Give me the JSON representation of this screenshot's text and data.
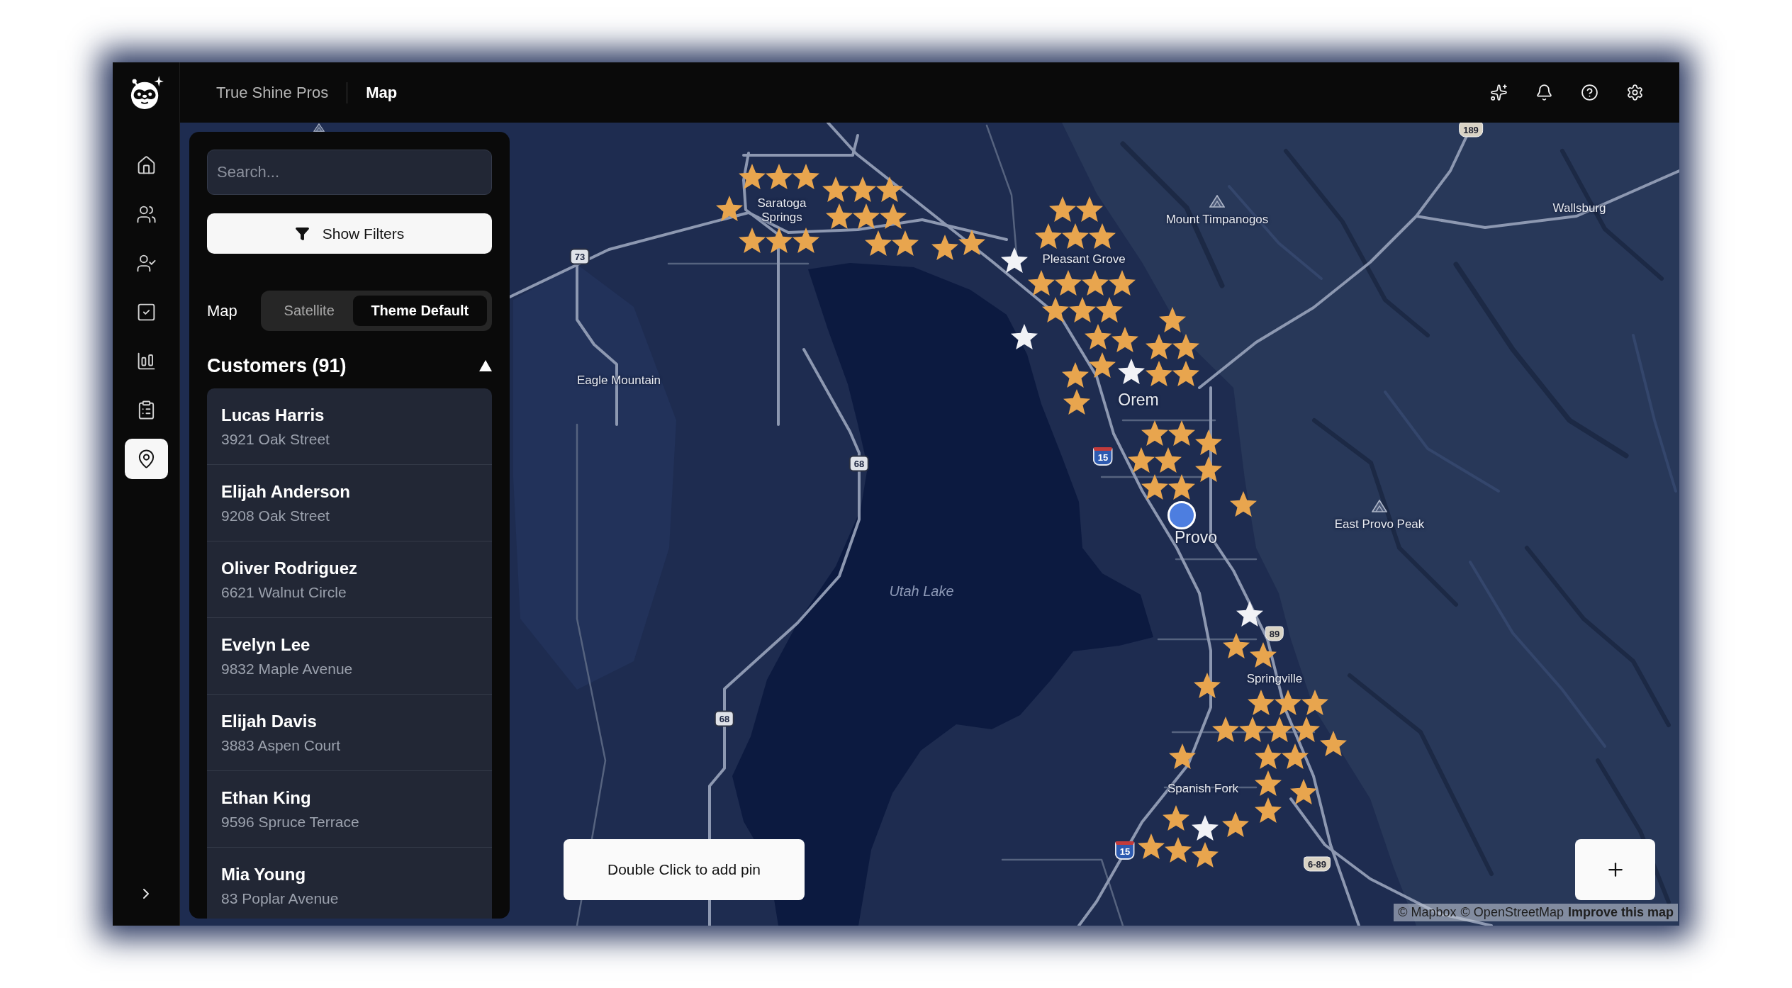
{
  "sidebar": {
    "items": [
      {
        "kind": "house",
        "selected": false
      },
      {
        "kind": "people",
        "selected": false
      },
      {
        "kind": "person-check",
        "selected": false
      },
      {
        "kind": "checkbox",
        "selected": false
      },
      {
        "kind": "bar-chart",
        "selected": false
      },
      {
        "kind": "clipboard",
        "selected": false
      },
      {
        "kind": "map-pin",
        "selected": true
      }
    ]
  },
  "topbar": {
    "breadcrumbs": [
      {
        "label": "True Shine Pros",
        "current": false
      },
      {
        "label": "Map",
        "current": true
      }
    ]
  },
  "panel": {
    "search": {
      "placeholder": "Search..."
    },
    "filter_button": "Show Filters",
    "map_style": {
      "label": "Map",
      "options": [
        {
          "label": "Satellite",
          "selected": false
        },
        {
          "label": "Theme Default",
          "selected": true
        }
      ]
    },
    "customers": {
      "title": "Customers (91)",
      "expanded": true,
      "items": [
        {
          "name": "Lucas Harris",
          "address": "3921 Oak Street"
        },
        {
          "name": "Elijah Anderson",
          "address": "9208 Oak Street"
        },
        {
          "name": "Oliver Rodriguez",
          "address": "6621 Walnut Circle"
        },
        {
          "name": "Evelyn Lee",
          "address": "9832 Maple Avenue"
        },
        {
          "name": "Elijah Davis",
          "address": "3883 Aspen Court"
        },
        {
          "name": "Ethan King",
          "address": "9596 Spruce Terrace"
        },
        {
          "name": "Mia Young",
          "address": "83 Poplar Avenue"
        }
      ]
    }
  },
  "map": {
    "labels": [
      {
        "text": "Saratoga Springs",
        "kind": "town"
      },
      {
        "text": "Pleasant Grove",
        "kind": "town"
      },
      {
        "text": "Mount Timpanogos",
        "kind": "peak"
      },
      {
        "text": "Wallsburg",
        "kind": "town"
      },
      {
        "text": "Eagle Mountain",
        "kind": "town"
      },
      {
        "text": "Orem",
        "kind": "city"
      },
      {
        "text": "Provo",
        "kind": "city"
      },
      {
        "text": "East Provo Peak",
        "kind": "peak"
      },
      {
        "text": "Utah Lake",
        "kind": "lake"
      },
      {
        "text": "Springville",
        "kind": "town"
      },
      {
        "text": "Spanish Fork",
        "kind": "town"
      }
    ],
    "shields": [
      {
        "text": "189",
        "kind": "us"
      },
      {
        "text": "73",
        "kind": "state"
      },
      {
        "text": "15",
        "kind": "interstate"
      },
      {
        "text": "68",
        "kind": "state"
      },
      {
        "text": "89",
        "kind": "us"
      },
      {
        "text": "68",
        "kind": "state"
      },
      {
        "text": "15",
        "kind": "interstate"
      },
      {
        "text": "6-89",
        "kind": "us"
      }
    ],
    "markers": [
      {
        "color": "#e8a54e"
      },
      {
        "color": "#e8a54e"
      },
      {
        "color": "#e8a54e"
      },
      {
        "color": "#e8a54e"
      },
      {
        "color": "#e8a54e"
      },
      {
        "color": "#e8a54e"
      },
      {
        "color": "#e8a54e"
      },
      {
        "color": "#e8a54e"
      },
      {
        "color": "#e8a54e"
      },
      {
        "color": "#e8a54e"
      },
      {
        "color": "#e8a54e"
      },
      {
        "color": "#e8a54e"
      },
      {
        "color": "#e8a54e"
      },
      {
        "color": "#e8a54e"
      },
      {
        "color": "#e8a54e"
      },
      {
        "color": "#e8a54e"
      },
      {
        "color": "#e8a54e"
      },
      {
        "color": "#f1f2f6"
      },
      {
        "color": "#e8a54e"
      },
      {
        "color": "#e8a54e"
      },
      {
        "color": "#e8a54e"
      },
      {
        "color": "#e8a54e"
      },
      {
        "color": "#e8a54e"
      },
      {
        "color": "#e8a54e"
      },
      {
        "color": "#e8a54e"
      },
      {
        "color": "#e8a54e"
      },
      {
        "color": "#e8a54e"
      },
      {
        "color": "#e8a54e"
      },
      {
        "color": "#e8a54e"
      },
      {
        "color": "#e8a54e"
      },
      {
        "color": "#f1f2f6"
      },
      {
        "color": "#e8a54e"
      },
      {
        "color": "#e8a54e"
      },
      {
        "color": "#e8a54e"
      },
      {
        "color": "#e8a54e"
      },
      {
        "color": "#e8a54e"
      },
      {
        "color": "#f1f2f6"
      },
      {
        "color": "#e8a54e"
      },
      {
        "color": "#e8a54e"
      },
      {
        "color": "#e8a54e"
      },
      {
        "color": "#e8a54e"
      },
      {
        "color": "#e8a54e"
      },
      {
        "color": "#e8a54e"
      },
      {
        "color": "#e8a54e"
      },
      {
        "color": "#e8a54e"
      },
      {
        "color": "#e8a54e"
      },
      {
        "color": "#e8a54e"
      },
      {
        "color": "#e8a54e"
      },
      {
        "color": "#e8a54e"
      },
      {
        "color": "#e8a54e"
      },
      {
        "color": "#e8a54e"
      },
      {
        "color": "#f1f2f6"
      },
      {
        "color": "#e8a54e"
      },
      {
        "color": "#e8a54e"
      },
      {
        "color": "#e8a54e"
      },
      {
        "color": "#e8a54e"
      },
      {
        "color": "#e8a54e"
      },
      {
        "color": "#e8a54e"
      },
      {
        "color": "#e8a54e"
      },
      {
        "color": "#e8a54e"
      },
      {
        "color": "#e8a54e"
      },
      {
        "color": "#e8a54e"
      },
      {
        "color": "#e8a54e"
      },
      {
        "color": "#e8a54e"
      },
      {
        "color": "#e8a54e"
      },
      {
        "color": "#e8a54e"
      },
      {
        "color": "#e8a54e"
      },
      {
        "color": "#e8a54e"
      },
      {
        "color": "#e8a54e"
      },
      {
        "color": "#e8a54e"
      },
      {
        "color": "#e8a54e"
      },
      {
        "color": "#e8a54e"
      },
      {
        "color": "#e8a54e"
      },
      {
        "color": "#e8a54e"
      },
      {
        "color": "#f1f2f6"
      }
    ],
    "hint": "Double Click to add pin",
    "attribution": [
      {
        "text": "© Mapbox",
        "bold": false
      },
      {
        "text": "© OpenStreetMap",
        "bold": false
      },
      {
        "text": "Improve this map",
        "bold": true
      }
    ]
  }
}
